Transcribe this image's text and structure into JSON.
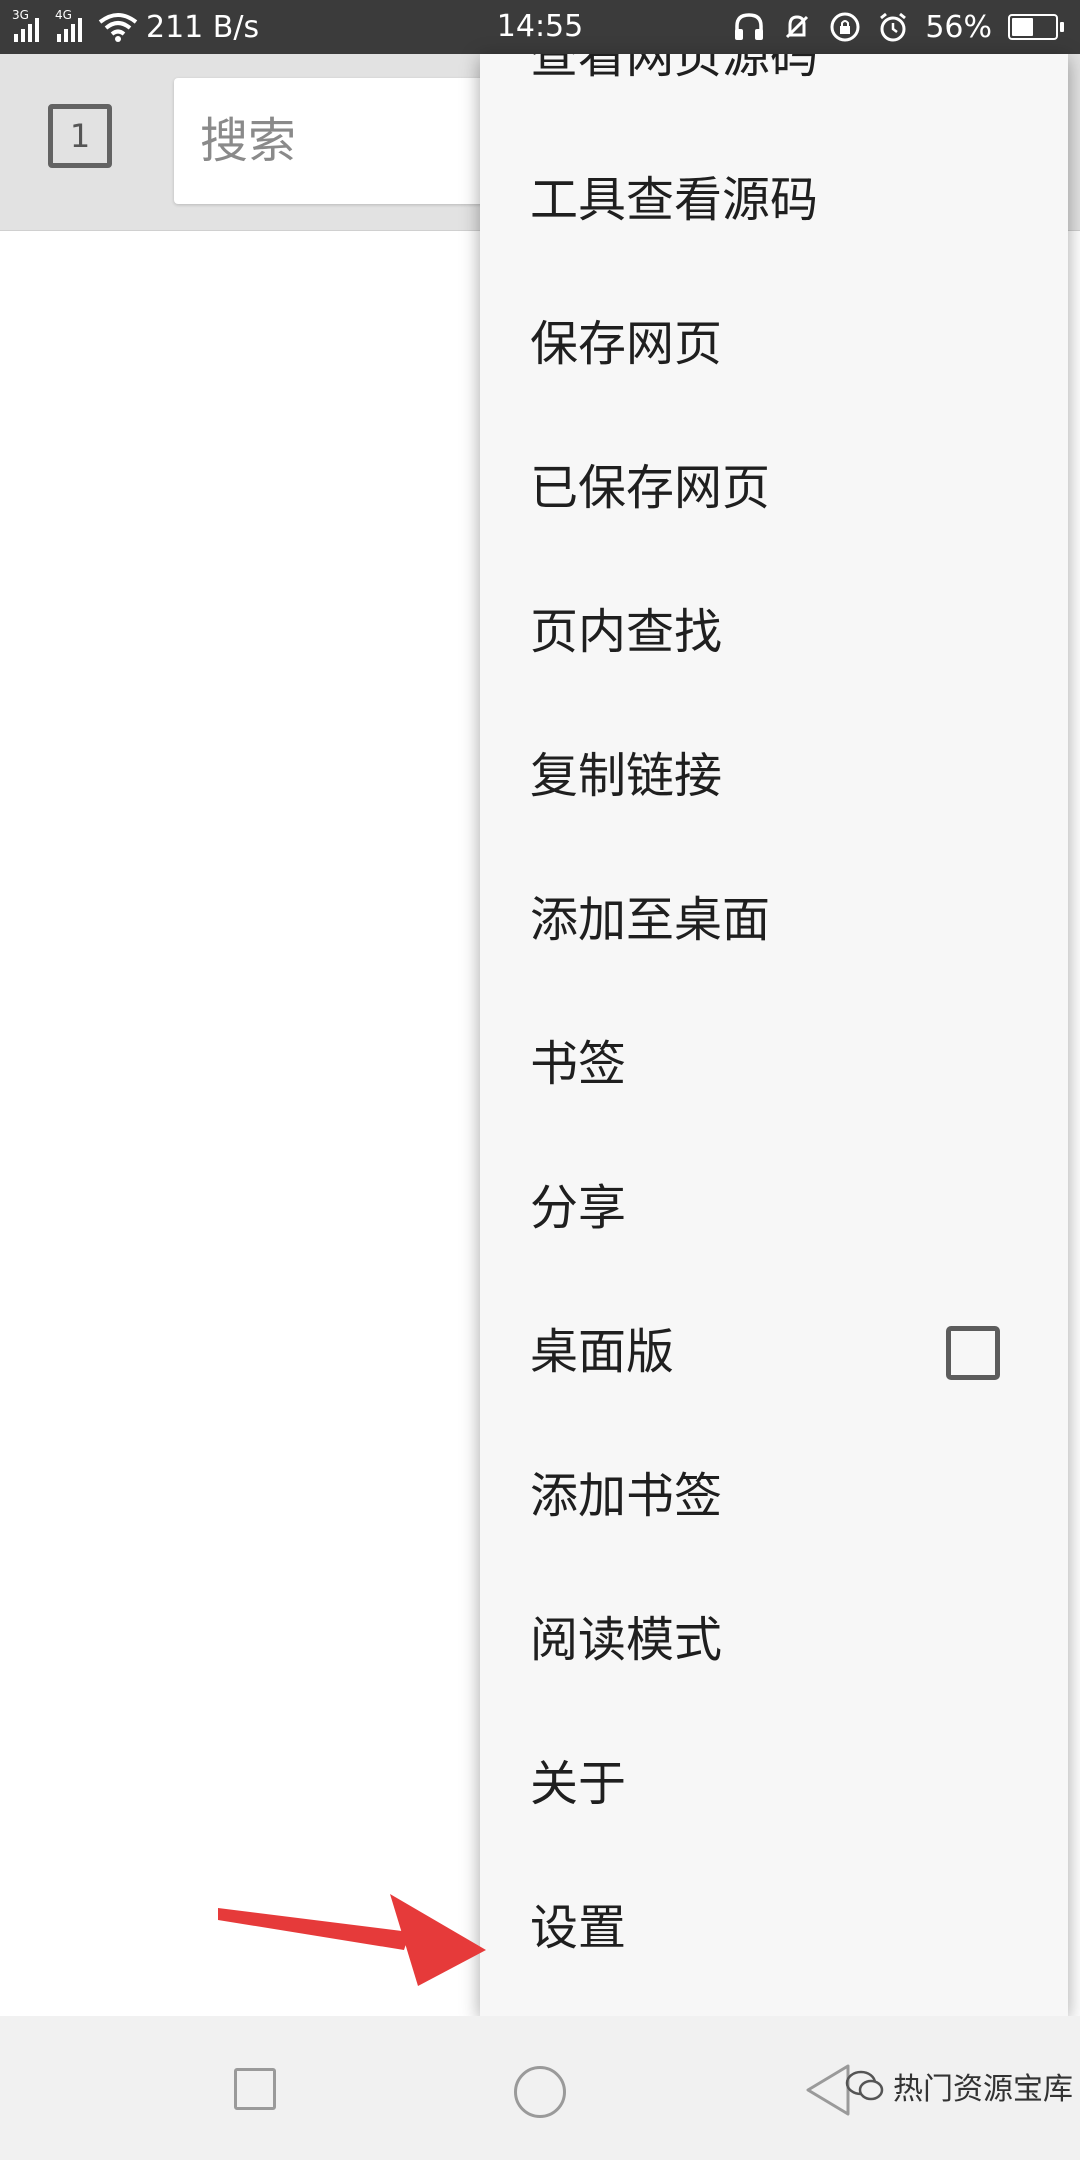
{
  "status_bar": {
    "signal1_label": "3G",
    "signal2_label": "4G",
    "net_speed": "211 B/s",
    "time": "14:55",
    "battery": "56%",
    "battery_level": 0.56,
    "icons": [
      "signal-3g-icon",
      "signal-4g-icon",
      "wifi-icon",
      "headphones-icon",
      "vibrate-off-icon",
      "lock-rotation-icon",
      "alarm-icon",
      "battery-icon"
    ]
  },
  "toolbar": {
    "tab_count": "1",
    "search_placeholder": "搜索"
  },
  "menu": {
    "items": [
      {
        "label": "查看网页源码"
      },
      {
        "label": "工具查看源码"
      },
      {
        "label": "保存网页"
      },
      {
        "label": "已保存网页"
      },
      {
        "label": "页内查找"
      },
      {
        "label": "复制链接"
      },
      {
        "label": "添加至桌面"
      },
      {
        "label": "书签"
      },
      {
        "label": "分享"
      },
      {
        "label": "桌面版",
        "checkbox": false
      },
      {
        "label": "添加书签"
      },
      {
        "label": "阅读模式"
      },
      {
        "label": "关于"
      },
      {
        "label": "设置"
      }
    ]
  },
  "navbar": {
    "icons": [
      "recent-apps-icon",
      "home-icon",
      "back-icon"
    ],
    "watermark": "热门资源宝库"
  },
  "annotation": {
    "arrow_color": "#e63a3a"
  }
}
